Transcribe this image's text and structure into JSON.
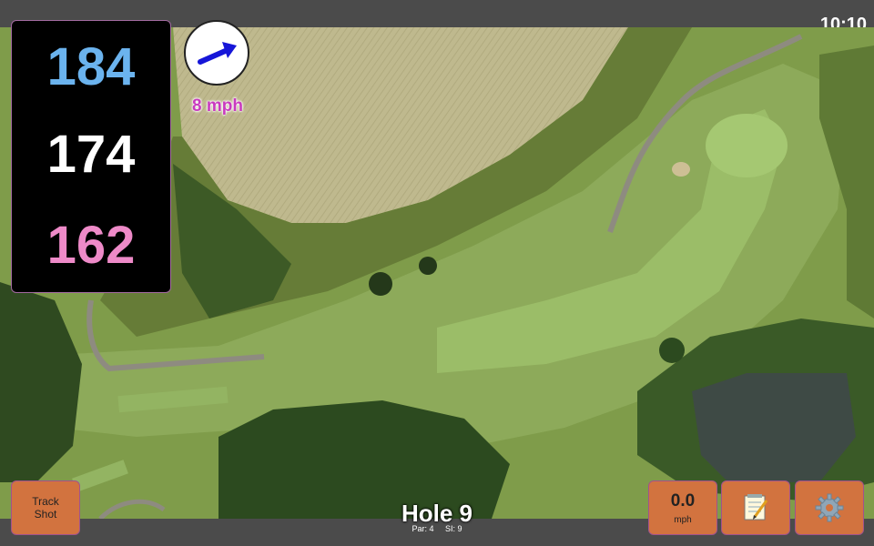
{
  "status": {
    "time": "10:10"
  },
  "distances": {
    "back": "184",
    "middle": "174",
    "front": "162"
  },
  "wind": {
    "speed_label": "8 mph",
    "direction_icon": "arrow-icon"
  },
  "hole": {
    "title": "Hole 9",
    "par": "Par: 4",
    "stroke_index": "SI: 9"
  },
  "buttons": {
    "track_shot": "Track\nShot",
    "wind_value": "0.0",
    "wind_unit": "mph",
    "notes_icon": "notepad-icon",
    "settings_icon": "gear-icon"
  },
  "colors": {
    "back": "#6bb3ee",
    "middle": "#ffffff",
    "front": "#ee8ac8",
    "accent": "#d2733f",
    "wind_text": "#c93bbf"
  }
}
